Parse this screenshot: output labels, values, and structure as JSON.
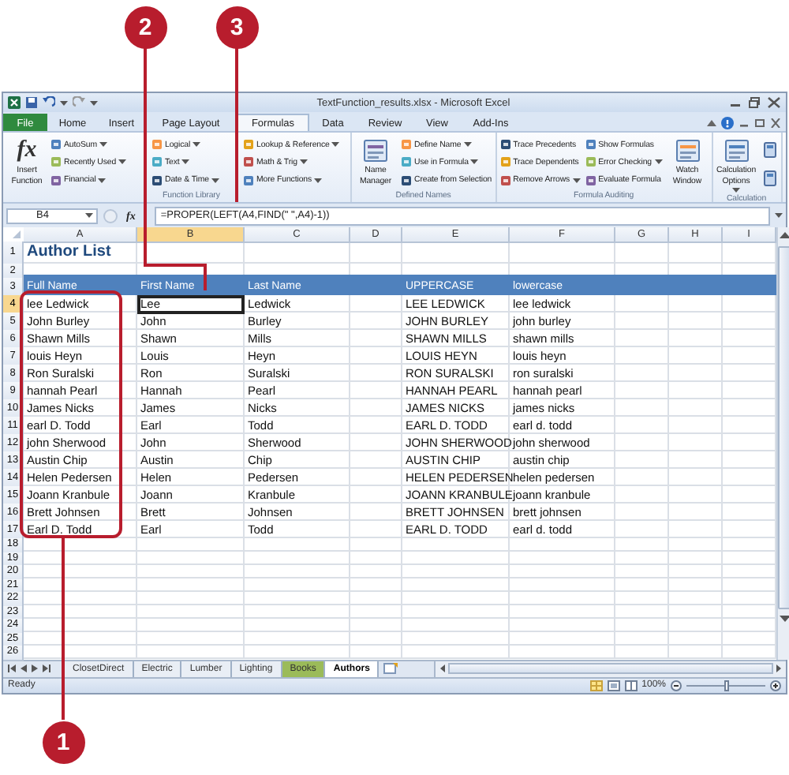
{
  "window": {
    "title": "TextFunction_results.xlsx - Microsoft Excel"
  },
  "ribbon_tabs": [
    {
      "label": "File",
      "kind": "backstage",
      "selected": false
    },
    {
      "label": "Home",
      "kind": "tab",
      "selected": false
    },
    {
      "label": "Insert",
      "kind": "tab",
      "selected": false
    },
    {
      "label": "Page Layout",
      "kind": "tab",
      "selected": false
    },
    {
      "label": "Formulas",
      "kind": "tab",
      "selected": true
    },
    {
      "label": "Data",
      "kind": "tab",
      "selected": false
    },
    {
      "label": "Review",
      "kind": "tab",
      "selected": false
    },
    {
      "label": "View",
      "kind": "tab",
      "selected": false
    },
    {
      "label": "Add-Ins",
      "kind": "tab",
      "selected": false
    }
  ],
  "ribbon_groups": [
    {
      "label": "Function Library",
      "commands": [
        {
          "label": "Insert Function",
          "kind": "large",
          "icon_text": "fx"
        },
        {
          "label": "AutoSum",
          "kind": "small",
          "dropdown": true
        },
        {
          "label": "Recently Used",
          "kind": "small",
          "dropdown": true
        },
        {
          "label": "Financial",
          "kind": "small",
          "dropdown": true
        },
        {
          "label": "Logical",
          "kind": "small",
          "dropdown": true
        },
        {
          "label": "Text",
          "kind": "small",
          "dropdown": true
        },
        {
          "label": "Date & Time",
          "kind": "small",
          "dropdown": true
        },
        {
          "label": "Lookup & Reference",
          "kind": "small",
          "dropdown": true
        },
        {
          "label": "Math & Trig",
          "kind": "small",
          "dropdown": true
        },
        {
          "label": "More Functions",
          "kind": "small",
          "dropdown": true
        }
      ]
    },
    {
      "label": "Defined Names",
      "commands": [
        {
          "label": "Name Manager",
          "kind": "large"
        },
        {
          "label": "Define Name",
          "kind": "small",
          "dropdown": true
        },
        {
          "label": "Use in Formula",
          "kind": "small",
          "dropdown": true
        },
        {
          "label": "Create from Selection",
          "kind": "small"
        }
      ]
    },
    {
      "label": "Formula Auditing",
      "commands": [
        {
          "label": "Trace Precedents",
          "kind": "small"
        },
        {
          "label": "Trace Dependents",
          "kind": "small"
        },
        {
          "label": "Remove Arrows",
          "kind": "small",
          "dropdown": true
        },
        {
          "label": "Show Formulas",
          "kind": "small"
        },
        {
          "label": "Error Checking",
          "kind": "small",
          "dropdown": true
        },
        {
          "label": "Evaluate Formula",
          "kind": "small"
        },
        {
          "label": "Watch Window",
          "kind": "large"
        }
      ]
    },
    {
      "label": "Calculation",
      "commands": [
        {
          "label": "Calculation Options",
          "kind": "large",
          "dropdown": true
        },
        {
          "kind": "icon"
        },
        {
          "kind": "icon"
        }
      ]
    }
  ],
  "name_box": "B4",
  "function_button": "fx",
  "formula": "=PROPER(LEFT(A4,FIND(\" \",A4)-1))",
  "columns": [
    {
      "label": "A",
      "selected": false
    },
    {
      "label": "B",
      "selected": true
    },
    {
      "label": "C",
      "selected": false
    },
    {
      "label": "D",
      "selected": false
    },
    {
      "label": "E",
      "selected": false
    },
    {
      "label": "F",
      "selected": false
    },
    {
      "label": "G",
      "selected": false
    },
    {
      "label": "H",
      "selected": false
    },
    {
      "label": "I",
      "selected": false
    }
  ],
  "rows": [
    {
      "number": "1",
      "kind": "title",
      "selected": false,
      "text": "Author List"
    },
    {
      "number": "2",
      "kind": "rule",
      "selected": false
    },
    {
      "number": "3",
      "kind": "header",
      "selected": false,
      "full_name": "Full Name",
      "first_name": "First Name",
      "last_name": "Last Name",
      "uppercase": "UPPERCASE",
      "lowercase": "lowercase"
    },
    {
      "number": "4",
      "kind": "data",
      "selected": true,
      "full_name": "lee Ledwick",
      "first_name": "Lee",
      "last_name": "Ledwick",
      "uppercase": "LEE LEDWICK",
      "lowercase": "lee ledwick"
    },
    {
      "number": "5",
      "kind": "data",
      "selected": false,
      "full_name": "John Burley",
      "first_name": "John",
      "last_name": "Burley",
      "uppercase": "JOHN BURLEY",
      "lowercase": "john burley"
    },
    {
      "number": "6",
      "kind": "data",
      "selected": false,
      "full_name": "Shawn Mills",
      "first_name": "Shawn",
      "last_name": "Mills",
      "uppercase": "SHAWN MILLS",
      "lowercase": "shawn mills"
    },
    {
      "number": "7",
      "kind": "data",
      "selected": false,
      "full_name": "louis Heyn",
      "first_name": "Louis",
      "last_name": "Heyn",
      "uppercase": "LOUIS HEYN",
      "lowercase": "louis heyn"
    },
    {
      "number": "8",
      "kind": "data",
      "selected": false,
      "full_name": "Ron Suralski",
      "first_name": "Ron",
      "last_name": "Suralski",
      "uppercase": "RON SURALSKI",
      "lowercase": "ron suralski"
    },
    {
      "number": "9",
      "kind": "data",
      "selected": false,
      "full_name": "hannah Pearl",
      "first_name": "Hannah",
      "last_name": "Pearl",
      "uppercase": "HANNAH PEARL",
      "lowercase": "hannah pearl"
    },
    {
      "number": "10",
      "kind": "data",
      "selected": false,
      "full_name": "James Nicks",
      "first_name": "James",
      "last_name": "Nicks",
      "uppercase": "JAMES NICKS",
      "lowercase": "james nicks"
    },
    {
      "number": "11",
      "kind": "data",
      "selected": false,
      "full_name": "earl D. Todd",
      "first_name": "Earl",
      "last_name": "Todd",
      "uppercase": "EARL D. TODD",
      "lowercase": "earl d. todd"
    },
    {
      "number": "12",
      "kind": "data",
      "selected": false,
      "full_name": "john Sherwood",
      "first_name": "John",
      "last_name": "Sherwood",
      "uppercase": "JOHN SHERWOOD",
      "lowercase": "john sherwood"
    },
    {
      "number": "13",
      "kind": "data",
      "selected": false,
      "full_name": "Austin Chip",
      "first_name": "Austin",
      "last_name": "Chip",
      "uppercase": "AUSTIN CHIP",
      "lowercase": "austin chip"
    },
    {
      "number": "14",
      "kind": "data",
      "selected": false,
      "full_name": "Helen Pedersen",
      "first_name": "Helen",
      "last_name": "Pedersen",
      "uppercase": "HELEN PEDERSEN",
      "lowercase": "helen pedersen"
    },
    {
      "number": "15",
      "kind": "data",
      "selected": false,
      "full_name": "Joann Kranbule",
      "first_name": "Joann",
      "last_name": "Kranbule",
      "uppercase": "JOANN KRANBULE",
      "lowercase": "joann kranbule"
    },
    {
      "number": "16",
      "kind": "data",
      "selected": false,
      "full_name": "Brett Johnsen",
      "first_name": "Brett",
      "last_name": "Johnsen",
      "uppercase": "BRETT JOHNSEN",
      "lowercase": "brett johnsen"
    },
    {
      "number": "17",
      "kind": "data",
      "selected": false,
      "full_name": "Earl D. Todd",
      "first_name": "Earl",
      "last_name": "Todd",
      "uppercase": "EARL D. TODD",
      "lowercase": "earl d. todd"
    },
    {
      "number": "18",
      "kind": "empty",
      "selected": false
    },
    {
      "number": "19",
      "kind": "empty",
      "selected": false
    },
    {
      "number": "20",
      "kind": "empty",
      "selected": false
    },
    {
      "number": "21",
      "kind": "empty",
      "selected": false
    },
    {
      "number": "22",
      "kind": "empty",
      "selected": false
    },
    {
      "number": "23",
      "kind": "empty",
      "selected": false
    },
    {
      "number": "24",
      "kind": "empty",
      "selected": false
    },
    {
      "number": "25",
      "kind": "empty",
      "selected": false
    },
    {
      "number": "26",
      "kind": "empty",
      "selected": false
    }
  ],
  "sheet_tabs": [
    {
      "label": "ClosetDirect",
      "selected": false
    },
    {
      "label": "Electric",
      "selected": false
    },
    {
      "label": "Lumber",
      "selected": false
    },
    {
      "label": "Lighting",
      "selected": false
    },
    {
      "label": "Books",
      "selected": false,
      "color": "#9bbb59"
    },
    {
      "label": "Authors",
      "selected": true
    }
  ],
  "status_bar": {
    "text": "Ready",
    "zoom": "100%",
    "zoom_slider": {
      "level": 0.5
    }
  },
  "callouts": [
    {
      "label": "2"
    },
    {
      "label": "3"
    },
    {
      "label": "1"
    }
  ]
}
